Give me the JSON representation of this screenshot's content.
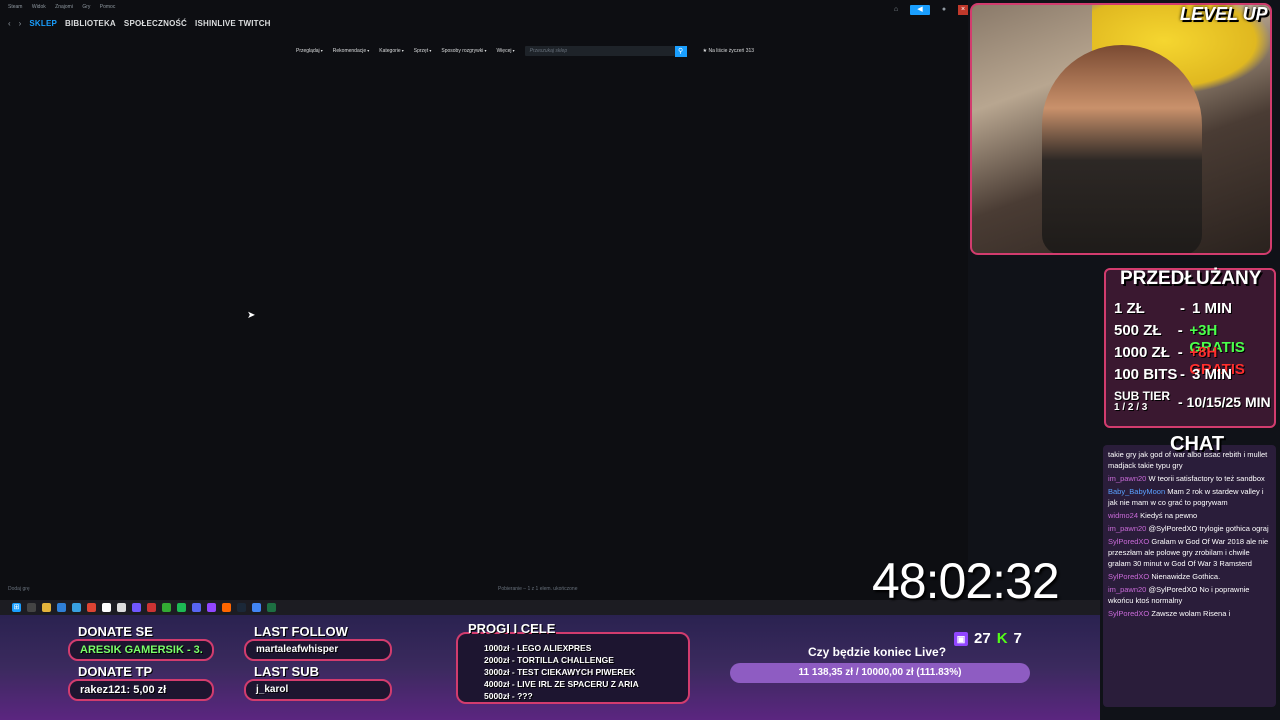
{
  "steam": {
    "menu": [
      "Steam",
      "Widok",
      "Znajomi",
      "Gry",
      "Pomoc"
    ],
    "tabs": [
      {
        "label": "SKLEP",
        "active": true
      },
      {
        "label": "BIBLIOTEKA",
        "active": false
      },
      {
        "label": "SPOŁECZNOŚĆ",
        "active": false
      },
      {
        "label": "ISHINLIVE TWITCH",
        "active": false
      }
    ],
    "store_nav": [
      "Przeglądaj",
      "Rekomendacje",
      "Kategorie",
      "Sprzęt",
      "Sposoby rozgrywki",
      "Więcej"
    ],
    "search_placeholder": "Przeszukaj sklep",
    "wishlist": "★ Na liście życzeń 313",
    "status_left": "Dodaj grę",
    "status_mid": "Pobieranie – 1 z 1 elem. ukończone"
  },
  "overlay": {
    "level_up": "LEVEL UP",
    "price_title": "PRZEDŁUŻANY",
    "prices": [
      {
        "amount": "1 ZŁ",
        "dash": "-",
        "value": "1 MIN",
        "color": "white"
      },
      {
        "amount": "500 ZŁ",
        "dash": "-",
        "value": "+3H GRATIS",
        "color": "green"
      },
      {
        "amount": "1000 ZŁ",
        "dash": "-",
        "value": "+8H GRATIS",
        "color": "red"
      },
      {
        "amount": "100 BITS",
        "dash": "-",
        "value": "3 MIN",
        "color": "white"
      }
    ],
    "sub_label": "SUB TIER",
    "sub_tiers": "1 / 2 / 3",
    "sub_value": "- 10/15/25 MIN",
    "chat_title": "CHAT",
    "chat": [
      {
        "user": "",
        "text": "takie gry jak god of war albo issac rebith i mullet madjack takie typu gry"
      },
      {
        "user": "im_pawn20",
        "text": "W teorii satisfactory to też sandbox"
      },
      {
        "user": "Baby_BabyMoon",
        "text": "Mam 2 rok w stardew valley i jak nie mam w co grać to pogrywam"
      },
      {
        "user": "widmo24",
        "text": "Kiedyś na pewno"
      },
      {
        "user": "im_pawn20",
        "text": "@SylPoredXO trylogie gothica ograj"
      },
      {
        "user": "SylPoredXO",
        "text": "Gralam w God Of War 2018 ale nie przeszłam ale polowe gry zrobilam i chwile gralam 30 minut w God Of War 3 Ramsterd"
      },
      {
        "user": "SylPoredXO",
        "text": "Nienawidze Gothica."
      },
      {
        "user": "im_pawn20",
        "text": "@SylPoredXO No i poprawnie wkońcu ktoś normalny"
      },
      {
        "user": "SylPoredXO",
        "text": "Zawsze wolam Risena i"
      }
    ],
    "timer": "48:02:32",
    "donate_se_title": "DONATE SE",
    "donate_se_value": "ARESIK GAMERSIK - 3.",
    "donate_tp_title": "DONATE TP",
    "donate_tp_value": "rakez121: 5,00 zł",
    "last_follow_title": "LAST FOLLOW",
    "last_follow_value": "martaleafwhisper",
    "last_sub_title": "LAST SUB",
    "last_sub_value": "j_karol",
    "goals_title": "PROGI I CELE",
    "goals": [
      "1000zł - LEGO ALIEXPRES",
      "2000zł - TORTILLA CHALLENGE",
      "3000zł - TEST CIEKAWYCH PIWEREK",
      "4000zł - LIVE IRL ZE SPACERU Z ARIA",
      "5000zł - ???"
    ],
    "end_title": "Czy będzie koniec Live?",
    "end_bar": "11 138,35 zł / 10000,00 zł (111.83%)",
    "twitch_count": "27",
    "kick_count": "7"
  }
}
